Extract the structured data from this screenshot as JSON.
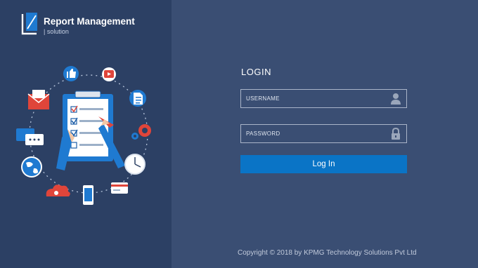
{
  "brand": {
    "title": "Report Management",
    "subtitle": "| solution"
  },
  "login": {
    "heading": "LOGIN",
    "username_placeholder": "USERNAME",
    "password_placeholder": "PASSWORD",
    "button_label": "Log In"
  },
  "footer": {
    "copyright": "Copyright © 2018 by KPMG Technology Solutions Pvt Ltd"
  },
  "colors": {
    "left_panel": "#2c4064",
    "right_panel": "#3a4e73",
    "primary_button": "#0a74c6",
    "accent_red": "#e0453a",
    "accent_blue": "#1f7ad1"
  },
  "icons": [
    "brand-logo-icon",
    "user-icon",
    "lock-icon",
    "clipboard-checklist-icon",
    "thumbs-up-icon",
    "video-play-icon",
    "document-icon",
    "gear-icon",
    "clock-icon",
    "credit-card-icon",
    "mobile-phone-icon",
    "cloud-icon",
    "globe-icon",
    "chat-bubble-icon",
    "envelope-icon"
  ]
}
